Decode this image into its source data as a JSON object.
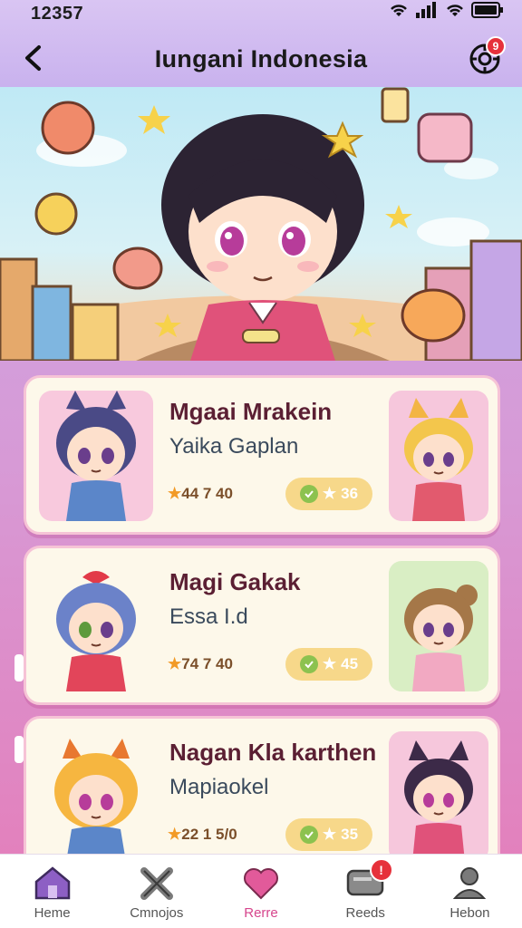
{
  "status": {
    "time": "12357"
  },
  "header": {
    "title": "Iungani Indonesia",
    "notification_count": "9"
  },
  "cards": [
    {
      "title": "Mgaai Mrakein",
      "subtitle": "Yaika Gaplan",
      "stats": "44 7 40",
      "pill_value": "36"
    },
    {
      "title": "Magi Gakak",
      "subtitle": "Essa I.d",
      "stats": "74 7 40",
      "pill_value": "45"
    },
    {
      "title": "Nagan Kla karthen",
      "subtitle": "Mapiaokel",
      "stats": "22 1 5/0",
      "pill_value": "35"
    }
  ],
  "nav": [
    {
      "label": "Heme",
      "icon": "home-icon"
    },
    {
      "label": "Cmnojos",
      "icon": "tools-icon"
    },
    {
      "label": "Rerre",
      "icon": "heart-icon"
    },
    {
      "label": "Reeds",
      "icon": "chat-icon",
      "badge": "!"
    },
    {
      "label": "Hebon",
      "icon": "profile-icon"
    }
  ],
  "colors": {
    "accent": "#d6458c",
    "badge": "#e6313b",
    "header_bg": "#d9c5f3"
  }
}
